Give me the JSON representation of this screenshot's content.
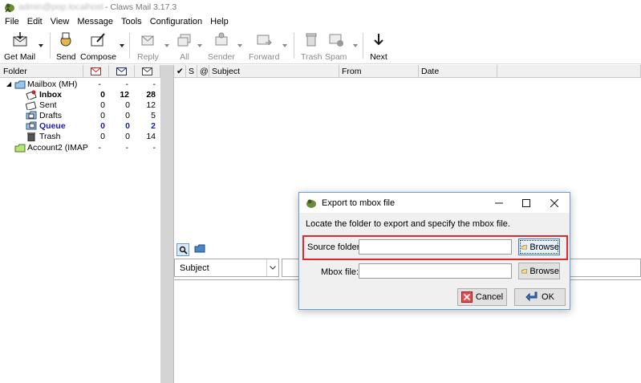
{
  "window": {
    "account_email_blurred": "admin@pop.localhost",
    "title": " - Claws Mail 3.17.3"
  },
  "menu": [
    "File",
    "Edit",
    "View",
    "Message",
    "Tools",
    "Configuration",
    "Help"
  ],
  "toolbar": {
    "get_mail": "Get Mail",
    "send": "Send",
    "compose": "Compose",
    "reply": "Reply",
    "all": "All",
    "sender": "Sender",
    "forward": "Forward",
    "trash": "Trash",
    "spam": "Spam",
    "next": "Next"
  },
  "folder_pane": {
    "header_label": "Folder",
    "rows": [
      {
        "name": "Mailbox (MH)",
        "new": "-",
        "unread": "-",
        "total": "-"
      },
      {
        "name": "Inbox",
        "new": "0",
        "unread": "12",
        "total": "28"
      },
      {
        "name": "Sent",
        "new": "0",
        "unread": "0",
        "total": "12"
      },
      {
        "name": "Drafts",
        "new": "0",
        "unread": "0",
        "total": "5"
      },
      {
        "name": "Queue",
        "new": "0",
        "unread": "0",
        "total": "2"
      },
      {
        "name": "Trash",
        "new": "0",
        "unread": "0",
        "total": "14"
      },
      {
        "name": "Account2 (IMAP",
        "new": "-",
        "unread": "-",
        "total": "-"
      }
    ]
  },
  "message_list": {
    "col_check": "✔",
    "col_s": "S",
    "col_attach": "@",
    "col_subject": "Subject",
    "col_from": "From",
    "col_date": "Date"
  },
  "search": {
    "field_selected": "Subject"
  },
  "dialog": {
    "title": "Export to mbox file",
    "description": "Locate the folder to export and specify the mbox file.",
    "source_label": "Source folder:",
    "source_value": "",
    "mbox_label": "Mbox file:",
    "mbox_value": "",
    "browse_label": "Browse",
    "cancel_label": "Cancel",
    "ok_label": "OK",
    "highlight_color": "#e0282c"
  }
}
